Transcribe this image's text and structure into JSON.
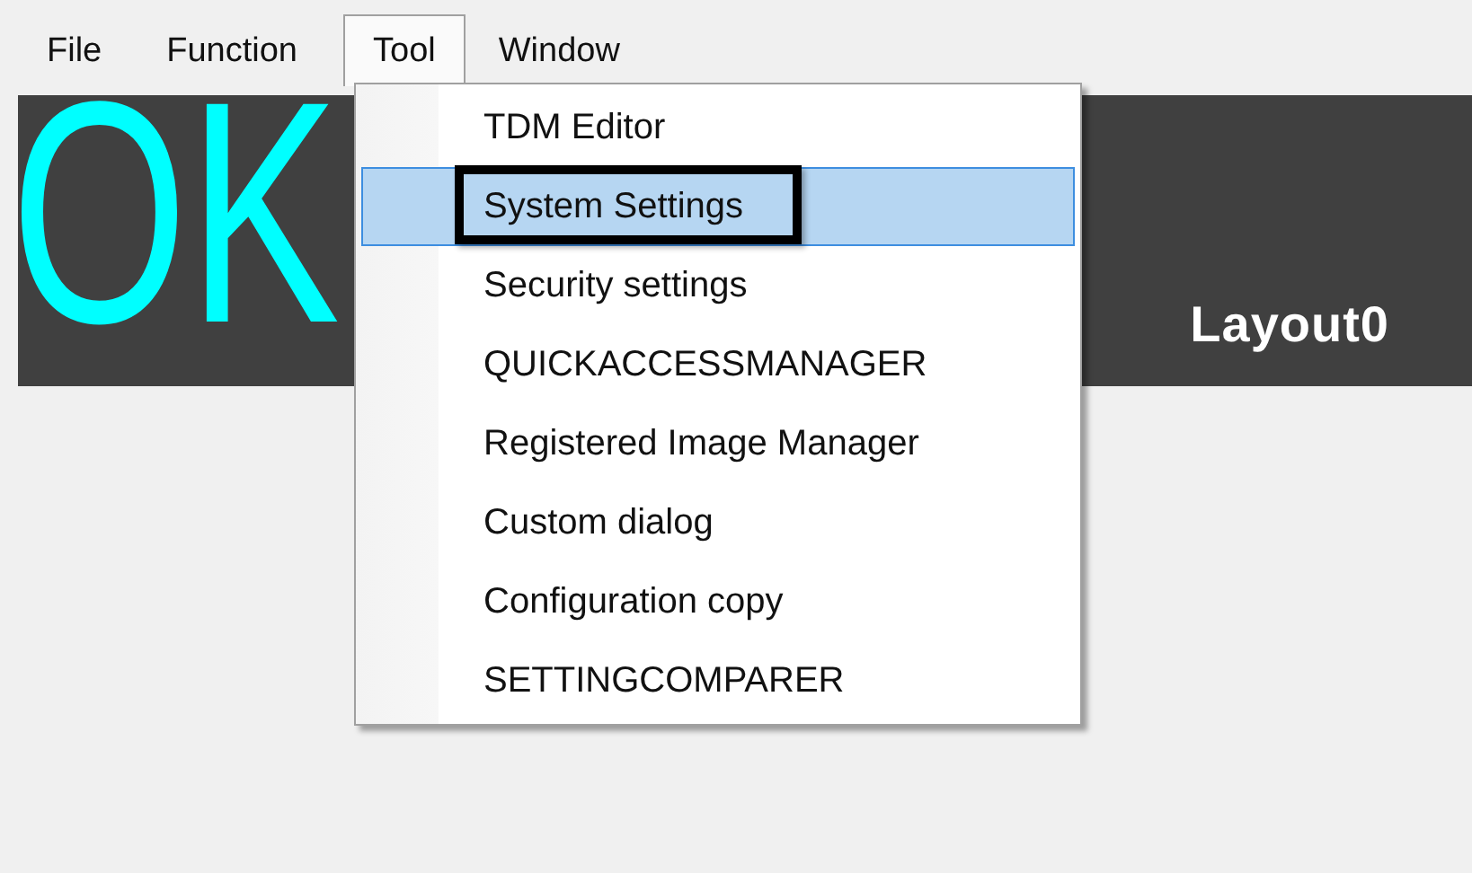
{
  "menubar": [
    {
      "label": "File",
      "open": false
    },
    {
      "label": "Function",
      "open": false
    },
    {
      "label": "Tool",
      "open": true
    },
    {
      "label": "Window",
      "open": false
    }
  ],
  "banner": {
    "status": "OK",
    "layout": "Layout0"
  },
  "dropdown": {
    "items": [
      {
        "label": "TDM Editor",
        "selected": false,
        "outlined": false
      },
      {
        "label": "System Settings",
        "selected": true,
        "outlined": true
      },
      {
        "label": "Security settings",
        "selected": false,
        "outlined": false
      },
      {
        "label": "QUICKACCESSMANAGER",
        "selected": false,
        "outlined": false
      },
      {
        "label": "Registered Image Manager",
        "selected": false,
        "outlined": false
      },
      {
        "label": "Custom dialog",
        "selected": false,
        "outlined": false
      },
      {
        "label": "Configuration copy",
        "selected": false,
        "outlined": false
      },
      {
        "label": "SETTINGCOMPARER",
        "selected": false,
        "outlined": false
      }
    ]
  }
}
